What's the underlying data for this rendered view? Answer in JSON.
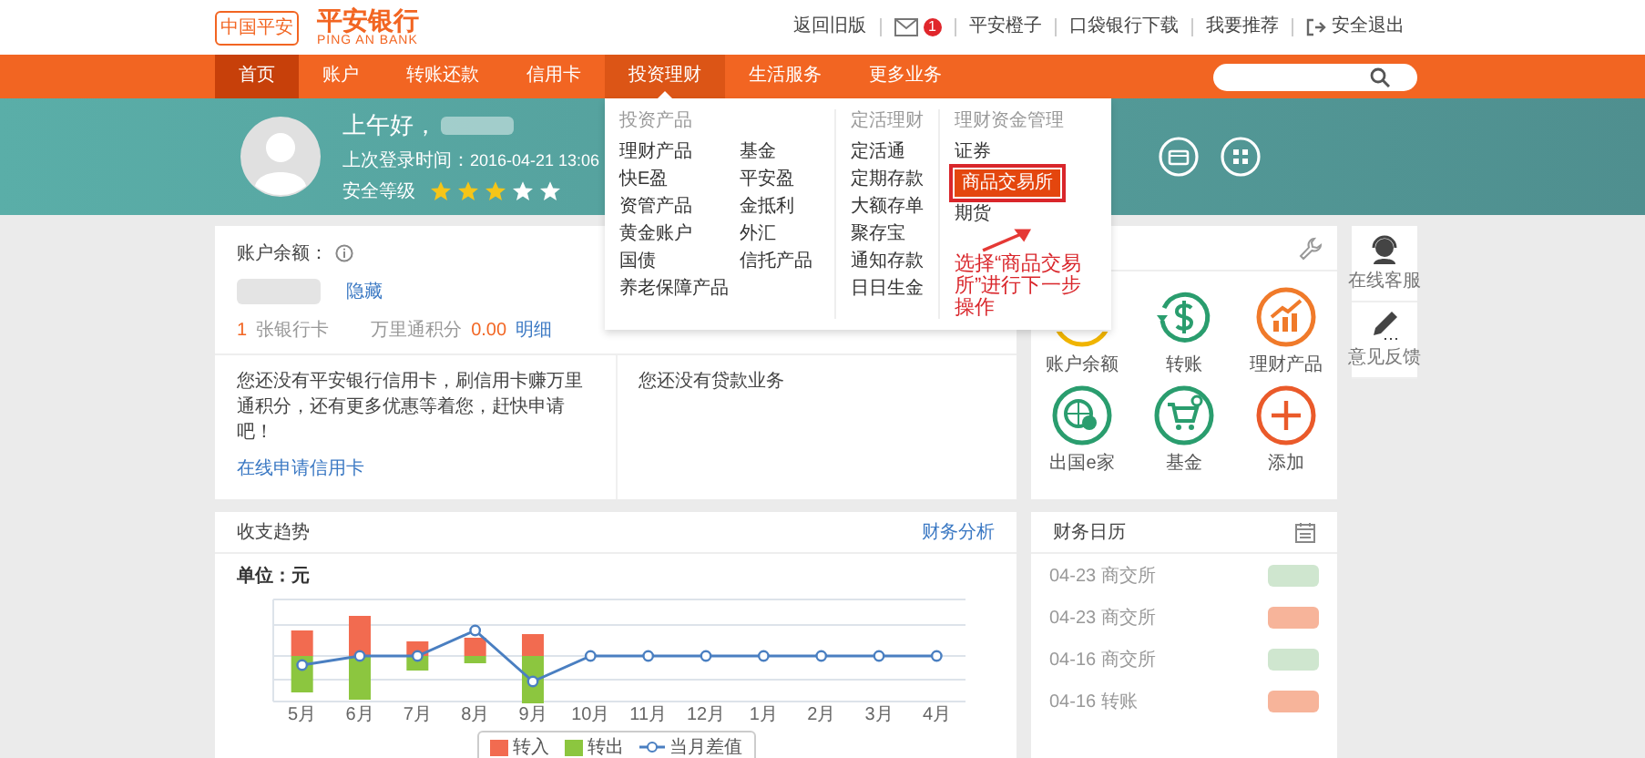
{
  "header": {
    "logo_mark": "中国平安",
    "brand": "平安银行",
    "brand_en": "PING AN BANK",
    "links": [
      {
        "kind": "text",
        "label": "返回旧版"
      },
      {
        "kind": "mail",
        "badge": "1"
      },
      {
        "kind": "text",
        "label": "平安橙子"
      },
      {
        "kind": "text",
        "label": "口袋银行下载"
      },
      {
        "kind": "text",
        "label": "我要推荐"
      },
      {
        "kind": "logout",
        "label": "安全退出"
      }
    ]
  },
  "nav": {
    "items": [
      {
        "label": "首页",
        "selected": true,
        "expanded": false
      },
      {
        "label": "账户",
        "selected": false,
        "expanded": false
      },
      {
        "label": "转账还款",
        "selected": false,
        "expanded": false
      },
      {
        "label": "信用卡",
        "selected": false,
        "expanded": false
      },
      {
        "label": "投资理财",
        "selected": false,
        "expanded": true
      },
      {
        "label": "生活服务",
        "selected": false,
        "expanded": false
      },
      {
        "label": "更多业务",
        "selected": false,
        "expanded": false
      }
    ]
  },
  "dropdown": {
    "groups": [
      {
        "title": "投资产品",
        "kind": "double",
        "items": [
          {
            "label": "理财产品",
            "selected": false
          },
          {
            "label": "基金",
            "selected": false
          },
          {
            "label": "快E盈",
            "selected": false
          },
          {
            "label": "平安盈",
            "selected": false
          },
          {
            "label": "资管产品",
            "selected": false
          },
          {
            "label": "金抵利",
            "selected": false
          },
          {
            "label": "黄金账户",
            "selected": false
          },
          {
            "label": "外汇",
            "selected": false
          },
          {
            "label": "国债",
            "selected": false
          },
          {
            "label": "信托产品",
            "selected": false
          },
          {
            "label": "养老保障产品",
            "selected": false
          }
        ]
      },
      {
        "title": "定活理财",
        "kind": "single",
        "items": [
          {
            "label": "定活通",
            "selected": false
          },
          {
            "label": "定期存款",
            "selected": false
          },
          {
            "label": "大额存单",
            "selected": false
          },
          {
            "label": "聚存宝",
            "selected": false
          },
          {
            "label": "通知存款",
            "selected": false
          },
          {
            "label": "日日生金",
            "selected": false
          }
        ]
      },
      {
        "title": "理财资金管理",
        "kind": "single",
        "items": [
          {
            "label": "证券",
            "selected": false
          },
          {
            "label": "商品交易所",
            "selected": true
          },
          {
            "label": "期货",
            "selected": false
          }
        ]
      }
    ],
    "annotation": "选择“商品交易所”进行下一步操作"
  },
  "banner": {
    "greeting": "上午好，",
    "last_login_label": "上次登录时间：",
    "last_login": "2016-04-21 13:06",
    "security_label": "安全等级",
    "stars": 3
  },
  "account": {
    "balance_label": "账户余额：",
    "hide_link": "隐藏",
    "card_count": "1",
    "card_label": "张银行卡",
    "points_label": "万里通积分",
    "points": "0.00",
    "detail_link": "明细",
    "credit_text": "您还没有平安银行信用卡，刷信用卡赚万里通积分，还有更多优惠等着您，赶快申请吧！",
    "credit_link": "在线申请信用卡",
    "loan_text": "您还没有贷款业务"
  },
  "quick": {
    "tiles": [
      {
        "kind": "balance",
        "label": "账户余额"
      },
      {
        "kind": "transfer",
        "label": "转账"
      },
      {
        "kind": "wealth",
        "label": "理财产品"
      },
      {
        "kind": "abroad",
        "label": "出国e家"
      },
      {
        "kind": "fund",
        "label": "基金"
      },
      {
        "kind": "add",
        "label": "添加"
      }
    ]
  },
  "trend": {
    "title": "收支趋势",
    "link": "财务分析",
    "unit": "单位：元",
    "months": [
      "5月",
      "6月",
      "7月",
      "8月",
      "9月",
      "10月",
      "11月",
      "12月",
      "1月",
      "2月",
      "3月",
      "4月"
    ],
    "legend": [
      {
        "kind": "bar",
        "label": "转入",
        "color": "#f26b50"
      },
      {
        "kind": "bar",
        "label": "转出",
        "color": "#8cc63f"
      },
      {
        "kind": "line",
        "label": "当月差值",
        "color": "#4a7fc1"
      }
    ]
  },
  "calendar": {
    "title": "财务日历",
    "events": [
      {
        "date": "04-23",
        "label": "商交所",
        "color": "#cfe6cf"
      },
      {
        "date": "04-23",
        "label": "商交所",
        "color": "#f7b49a"
      },
      {
        "date": "04-16",
        "label": "商交所",
        "color": "#cfe6cf"
      },
      {
        "date": "04-16",
        "label": "转账",
        "color": "#f7b49a"
      }
    ]
  },
  "side_tools": [
    {
      "kind": "service",
      "label": "在线客服"
    },
    {
      "kind": "feedback",
      "label": "意见反馈"
    }
  ]
}
